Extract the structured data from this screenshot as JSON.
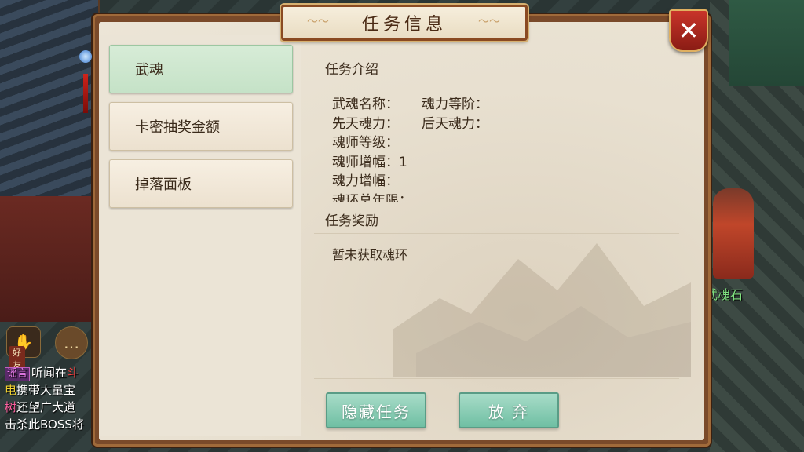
{
  "dialog": {
    "title": "任务信息",
    "close_symbol": "✕"
  },
  "sidebar": {
    "items": [
      {
        "label": "武魂",
        "active": true
      },
      {
        "label": "卡密抽奖金额",
        "active": false
      },
      {
        "label": "掉落面板",
        "active": false
      }
    ]
  },
  "task_intro": {
    "title": "任务介绍",
    "rows": [
      {
        "col1": "武魂名称：",
        "col2": "魂力等阶："
      },
      {
        "col1": "先天魂力：",
        "col2": "后天魂力："
      },
      {
        "col1": "魂师等级：",
        "col2": ""
      },
      {
        "col1": "魂师增幅：1",
        "col2": ""
      },
      {
        "col1": "魂力增幅：",
        "col2": ""
      },
      {
        "col1": "魂环总年限：",
        "col2": ""
      }
    ]
  },
  "task_reward": {
    "title": "任务奖励",
    "text": "暂未获取魂环"
  },
  "actions": {
    "hide_label": "隐藏任务",
    "abandon_label": "放 弃"
  },
  "hud": {
    "friend_label": "好友",
    "npc_name": "武魂石",
    "chat": [
      {
        "tag": "谣言",
        "text": "听闻在",
        "extra": "斗"
      },
      {
        "lead": "电",
        "text": "携带大量宝"
      },
      {
        "lead": "树",
        "text": "还望广大道"
      },
      {
        "text": "击杀此BOSS将"
      }
    ]
  },
  "icons": [
    "close-icon",
    "friend-icon",
    "chat-bubble-icon",
    "ornament-icon"
  ],
  "colors": {
    "accent_green": "#6fbfa3",
    "frame_brown": "#7a4a2a",
    "close_red": "#c8342a"
  }
}
